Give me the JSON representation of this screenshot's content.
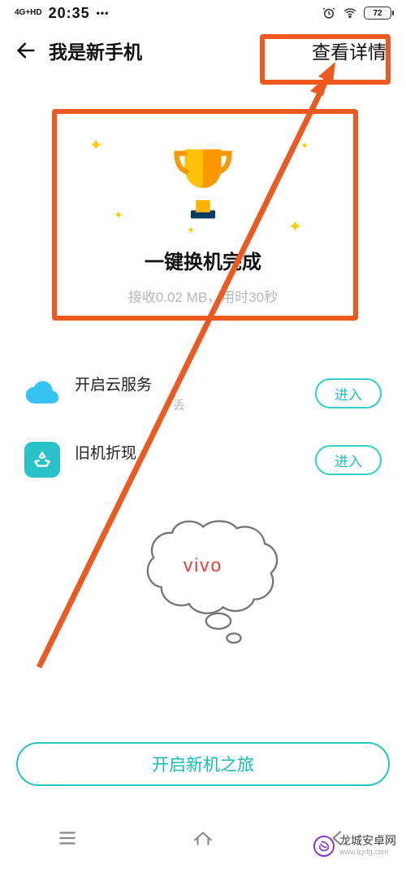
{
  "status": {
    "network_label": "4G+HD",
    "time": "20:35",
    "battery_pct": "72"
  },
  "nav": {
    "title": "我是新手机",
    "action_label": "查看详情"
  },
  "card": {
    "title": "一键换机完成",
    "subtitle": "接收0.02 MB，用时30秒"
  },
  "list": [
    {
      "icon": "cloud-icon",
      "title": "开启云服务",
      "subtitle_tail": "丢",
      "button": "进入"
    },
    {
      "icon": "recycle-icon",
      "title": "旧机折现",
      "subtitle_tail": "",
      "button": "进入"
    }
  ],
  "bubble": {
    "brand": "vivo"
  },
  "main_button": "开启新机之旅",
  "watermark": {
    "line1": "龙城安卓网",
    "line2": "www.lcjrfg.com"
  },
  "colors": {
    "accent": "#25c7bf",
    "annotation": "#ec5a1f"
  }
}
